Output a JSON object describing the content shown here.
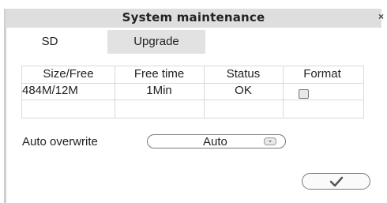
{
  "dialog": {
    "title": "System maintenance",
    "close_symbol": "×"
  },
  "tabs": [
    {
      "label": "SD",
      "selected": true
    },
    {
      "label": "Upgrade",
      "selected": false
    }
  ],
  "storage_table": {
    "headers": [
      "Size/Free",
      "Free time",
      "Status",
      "Format"
    ],
    "rows": [
      {
        "size_free": "484M/12M",
        "free_time": "1Min",
        "status": "OK",
        "format_checked": false
      }
    ]
  },
  "auto_overwrite": {
    "label": "Auto overwrite",
    "value": "Auto"
  },
  "confirm": {
    "icon": "checkmark-icon"
  }
}
